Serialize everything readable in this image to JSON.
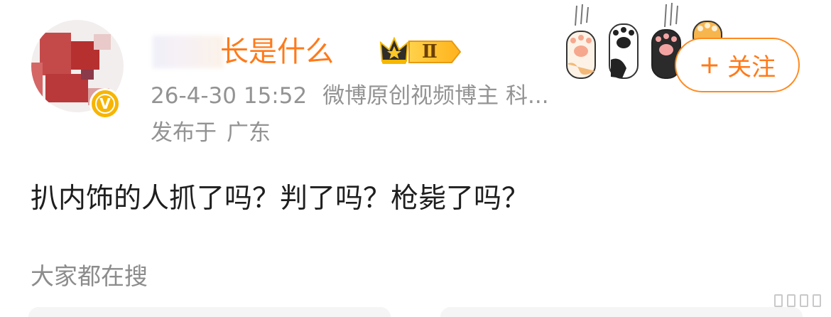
{
  "user": {
    "name": "长是什么",
    "level_badge": "Ⅱ",
    "verified_mark": "V"
  },
  "meta": {
    "timestamp": "26-4-30 15:52",
    "tag": "微博原创视频博主 科...",
    "location_prefix": "发布于",
    "location": "广东"
  },
  "actions": {
    "follow_label": "关注",
    "follow_icon": "+"
  },
  "post": {
    "text": "扒内饰的人抓了吗？判了吗？枪毙了吗？"
  },
  "section": {
    "trending_label": "大家都在搜"
  },
  "colors": {
    "accent": "#ff7a1a",
    "meta": "#939393",
    "text": "#1e1e1e",
    "verified": "#f7b500"
  }
}
